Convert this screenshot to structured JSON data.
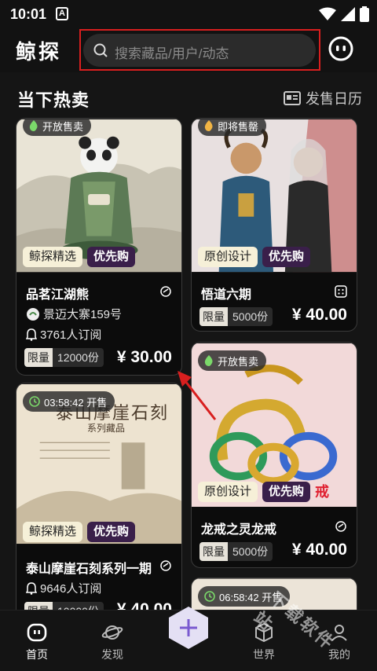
{
  "status": {
    "time": "10:01",
    "notification_letter": "A"
  },
  "header": {
    "app_title": "鲸探",
    "search_placeholder": "搜索藏品/用户/动态"
  },
  "section": {
    "title": "当下热卖",
    "calendar_label": "发售日历"
  },
  "cards": [
    {
      "badge": "开放售卖",
      "tags": [
        "鲸探精选",
        "优先购"
      ],
      "name": "品茗江湖熊",
      "publisher": "景迈大寨159号",
      "subscribers": "3761人订阅",
      "limit_label": "限量",
      "limit_count": "12000份",
      "price": "¥ 30.00"
    },
    {
      "badge": "即将售罄",
      "tags": [
        "原创设计",
        "优先购"
      ],
      "name": "悟道六期",
      "limit_label": "限量",
      "limit_count": "5000份",
      "price": "¥ 40.00"
    },
    {
      "badge": "03:58:42 开售",
      "image_text_title": "泰山摩崖石刻",
      "image_text_sub": "系列藏品",
      "tags": [
        "鲸探精选",
        "优先购"
      ],
      "name": "泰山摩崖石刻系列一期",
      "subscribers": "9646人订阅",
      "limit_label": "限量",
      "limit_count": "10000份",
      "price": "¥ 40.00"
    },
    {
      "badge": "开放售卖",
      "tags": [
        "原创设计",
        "优先购"
      ],
      "image_overlay_text": "戒",
      "name": "龙戒之灵龙戒",
      "limit_label": "限量",
      "limit_count": "5000份",
      "price": "¥ 40.00"
    },
    {
      "badge": "06:58:42 开售"
    }
  ],
  "nav": {
    "home": "首页",
    "discover": "发现",
    "world": "世界",
    "mine": "我的"
  },
  "watermark": "下载软件站",
  "colors": {
    "background": "#151515",
    "highlight_box": "#d81f1f",
    "priority_tag": "#3a1f4a",
    "card_border": "#3a3a3a"
  }
}
